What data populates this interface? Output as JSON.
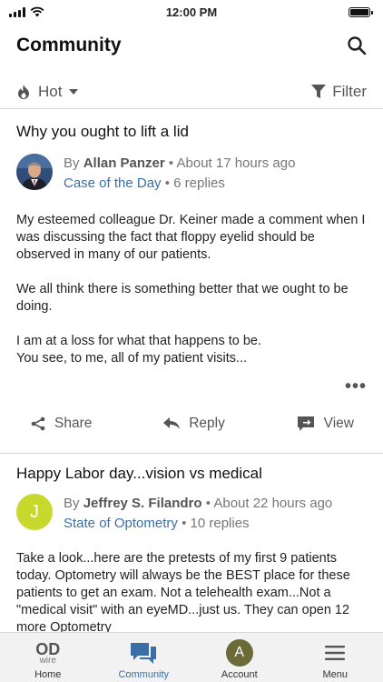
{
  "status_bar": {
    "time": "12:00 PM"
  },
  "header": {
    "title": "Community"
  },
  "toolbar": {
    "sort_label": "Hot",
    "filter_label": "Filter"
  },
  "posts": [
    {
      "title": "Why you ought to lift a lid",
      "by": "By",
      "author": "Allan Panzer",
      "time": "About 17 hours ago",
      "category": "Case of the Day",
      "replies": "6 replies",
      "body": [
        "My esteemed colleague Dr. Keiner made a comment when I was discussing the fact that floppy eyelid should be observed in many of our patients.",
        "We all think there is something better that we ought to be doing.",
        "I am at a loss for what that  happens to be.\nYou see, to me, all of my patient visits..."
      ],
      "more": "•••",
      "actions": {
        "share": "Share",
        "reply": "Reply",
        "view": "View"
      }
    },
    {
      "title": "Happy Labor day...vision vs medical",
      "by": "By",
      "author": "Jeffrey S. Filandro",
      "avatar_initial": "J",
      "avatar_color": "#c9d82c",
      "time": "About 22 hours ago",
      "category": "State of Optometry",
      "replies": "10 replies",
      "body": [
        "Take a look...here are the pretests of my first 9 patients today. Optometry will always be the BEST place for these patients to get an exam. Not a telehealth exam...Not a \"medical visit\" with an eyeMD...just us. They can open 12 more Optometry"
      ]
    }
  ],
  "tab_bar": {
    "logo_top": "OD",
    "logo_bottom": "wire",
    "account_initial": "A",
    "account_color": "#6b6b3a",
    "items": [
      {
        "label": "Home",
        "icon": "od-wire-logo"
      },
      {
        "label": "Community",
        "icon": "chat-bubbles-icon",
        "active": true
      },
      {
        "label": "Account",
        "icon": "avatar"
      },
      {
        "label": "Menu",
        "icon": "hamburger-icon"
      }
    ]
  },
  "colors": {
    "accent": "#3a6fa8",
    "text": "#222222",
    "muted": "#777777",
    "divider": "#d8d8d8"
  }
}
